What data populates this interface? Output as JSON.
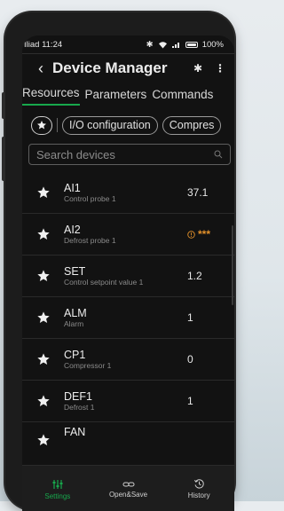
{
  "status_bar": {
    "carrier_time": "Iliad 11:24",
    "battery": "100%"
  },
  "app_bar": {
    "title": "Device Manager"
  },
  "tabs": [
    {
      "label": "Resources",
      "active": true
    },
    {
      "label": "Parameters",
      "active": false
    },
    {
      "label": "Commands",
      "active": false
    }
  ],
  "filters": {
    "chip1": "I/O configuration",
    "chip2": "Compres"
  },
  "search": {
    "placeholder": "Search devices"
  },
  "devices": [
    {
      "name": "AI1",
      "description": "Control probe 1",
      "value": "37.1"
    },
    {
      "name": "AI2",
      "description": "Defrost probe 1",
      "value": "***",
      "warning": true
    },
    {
      "name": "SET",
      "description": "Control setpoint value 1",
      "value": "1.2"
    },
    {
      "name": "ALM",
      "description": "Alarm",
      "value": "1"
    },
    {
      "name": "CP1",
      "description": "Compressor 1",
      "value": "0"
    },
    {
      "name": "DEF1",
      "description": "Defrost 1",
      "value": "1"
    },
    {
      "name": "FAN",
      "description": "",
      "value": ""
    }
  ],
  "bottom_nav": [
    {
      "label": "Settings",
      "icon": "settings-icon",
      "active": true
    },
    {
      "label": "Open&Save",
      "icon": "link-icon",
      "active": false
    },
    {
      "label": "History",
      "icon": "history-icon",
      "active": false
    }
  ],
  "colors": {
    "accent": "#17a84c",
    "warning": "#e2902a",
    "background": "#121212"
  }
}
